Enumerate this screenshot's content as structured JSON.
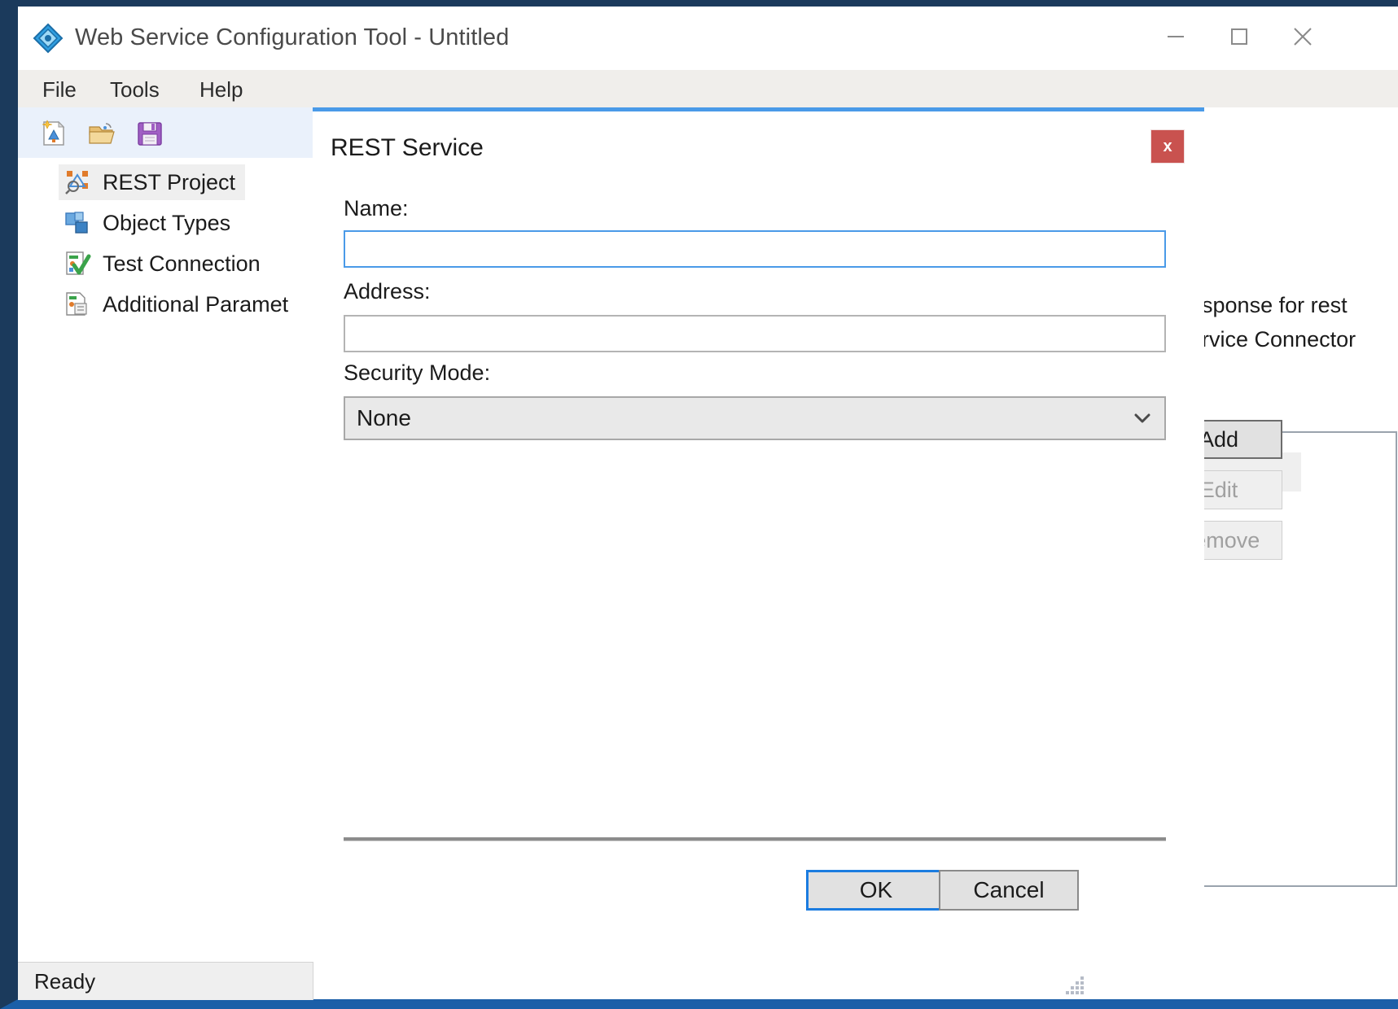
{
  "window": {
    "title": "Web Service Configuration Tool - Untitled",
    "icon": "app-diamond-icon",
    "controls": {
      "minimize": "minimize-icon",
      "maximize": "maximize-icon",
      "close": "close-icon"
    }
  },
  "menu": {
    "items": [
      {
        "label": "File"
      },
      {
        "label": "Tools"
      },
      {
        "label": "Help"
      }
    ]
  },
  "toolbar": {
    "buttons": [
      {
        "name": "new-project-icon"
      },
      {
        "name": "open-project-icon"
      },
      {
        "name": "save-project-icon"
      }
    ]
  },
  "sidebar": {
    "items": [
      {
        "label": "REST Project",
        "icon": "rest-project-icon",
        "selected": true
      },
      {
        "label": "Object Types",
        "icon": "object-types-icon",
        "selected": false
      },
      {
        "label": "Test Connection",
        "icon": "test-connection-icon",
        "selected": false
      },
      {
        "label": "Additional Paramet",
        "icon": "additional-parameters-icon",
        "selected": false
      }
    ]
  },
  "background": {
    "description_line1": "esponse for rest",
    "description_line2": "ervice Connector",
    "buttons": {
      "add": "Add",
      "edit": "Edit",
      "remove": "Remove"
    }
  },
  "dialog": {
    "title": "REST Service",
    "close_label": "x",
    "fields": {
      "name": {
        "label": "Name:",
        "value": "",
        "placeholder": ""
      },
      "address": {
        "label": "Address:",
        "value": "",
        "placeholder": ""
      },
      "security_mode": {
        "label": "Security Mode:",
        "value": "None",
        "options": [
          "None"
        ]
      }
    },
    "buttons": {
      "ok": "OK",
      "cancel": "Cancel"
    }
  },
  "status_bar": {
    "text": "Ready"
  },
  "colors": {
    "accent_blue": "#4a9ae8",
    "focus_blue": "#1b7ce0",
    "close_red": "#c9524f",
    "frame_navy": "#1b3a5c",
    "toolbar_blue": "#eaf1fb"
  }
}
